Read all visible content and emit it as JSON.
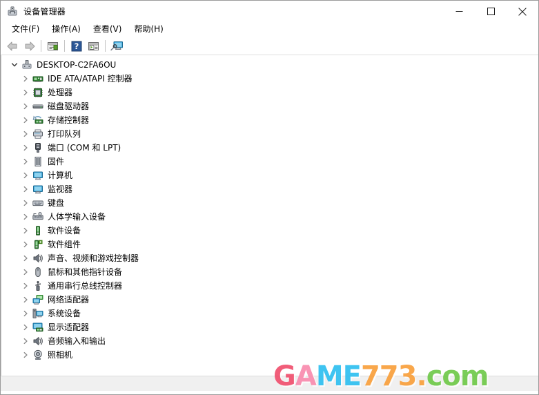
{
  "window": {
    "title": "设备管理器",
    "icon": "device-manager-icon",
    "controls": {
      "minimize": "最小化",
      "maximize": "最大化",
      "close": "关闭"
    }
  },
  "menubar": {
    "items": [
      {
        "label": "文件(F)",
        "name": "menu-file"
      },
      {
        "label": "操作(A)",
        "name": "menu-action"
      },
      {
        "label": "查看(V)",
        "name": "menu-view"
      },
      {
        "label": "帮助(H)",
        "name": "menu-help"
      }
    ]
  },
  "toolbar": {
    "buttons": [
      {
        "name": "back-button",
        "icon": "back-arrow-icon",
        "enabled": false
      },
      {
        "name": "forward-button",
        "icon": "forward-arrow-icon",
        "enabled": false
      },
      {
        "name": "properties-button",
        "icon": "properties-icon",
        "enabled": true
      },
      {
        "name": "help-button",
        "icon": "help-question-icon",
        "enabled": true
      },
      {
        "name": "show-hidden-button",
        "icon": "show-hidden-devices-icon",
        "enabled": true
      },
      {
        "name": "scan-hardware-button",
        "icon": "scan-hardware-changes-icon",
        "enabled": true
      }
    ]
  },
  "tree": {
    "root": {
      "label": "DESKTOP-C2FA6OU",
      "icon": "computer-root-icon",
      "expanded": true
    },
    "items": [
      {
        "label": "IDE ATA/ATAPI 控制器",
        "icon": "ide-controller-icon"
      },
      {
        "label": "处理器",
        "icon": "processor-icon"
      },
      {
        "label": "磁盘驱动器",
        "icon": "disk-drive-icon"
      },
      {
        "label": "存储控制器",
        "icon": "storage-controller-icon"
      },
      {
        "label": "打印队列",
        "icon": "print-queue-icon"
      },
      {
        "label": "端口 (COM 和 LPT)",
        "icon": "ports-icon"
      },
      {
        "label": "固件",
        "icon": "firmware-icon"
      },
      {
        "label": "计算机",
        "icon": "computer-icon"
      },
      {
        "label": "监视器",
        "icon": "monitor-icon"
      },
      {
        "label": "键盘",
        "icon": "keyboard-icon"
      },
      {
        "label": "人体学输入设备",
        "icon": "hid-icon"
      },
      {
        "label": "软件设备",
        "icon": "software-device-icon"
      },
      {
        "label": "软件组件",
        "icon": "software-component-icon"
      },
      {
        "label": "声音、视频和游戏控制器",
        "icon": "sound-video-game-icon"
      },
      {
        "label": "鼠标和其他指针设备",
        "icon": "mouse-icon"
      },
      {
        "label": "通用串行总线控制器",
        "icon": "usb-controller-icon"
      },
      {
        "label": "网络适配器",
        "icon": "network-adapter-icon"
      },
      {
        "label": "系统设备",
        "icon": "system-device-icon"
      },
      {
        "label": "显示适配器",
        "icon": "display-adapter-icon"
      },
      {
        "label": "音频输入和输出",
        "icon": "audio-io-icon"
      },
      {
        "label": "照相机",
        "icon": "camera-icon"
      }
    ]
  },
  "watermark": {
    "parts": [
      {
        "text": "G",
        "color": "#f0506e"
      },
      {
        "text": "A",
        "color": "#f98cae"
      },
      {
        "text": "M",
        "color": "#2fc0f0"
      },
      {
        "text": "E",
        "color": "#2fc0f0"
      },
      {
        "text": "7",
        "color": "#f9a03c"
      },
      {
        "text": "7",
        "color": "#f9a03c"
      },
      {
        "text": "3",
        "color": "#f9a03c"
      },
      {
        "text": ".",
        "color": "#f9a03c"
      },
      {
        "text": "c",
        "color": "#6fc94a"
      },
      {
        "text": "o",
        "color": "#6fc94a"
      },
      {
        "text": "m",
        "color": "#6fc94a"
      }
    ]
  },
  "statusbar": {
    "text": ""
  }
}
